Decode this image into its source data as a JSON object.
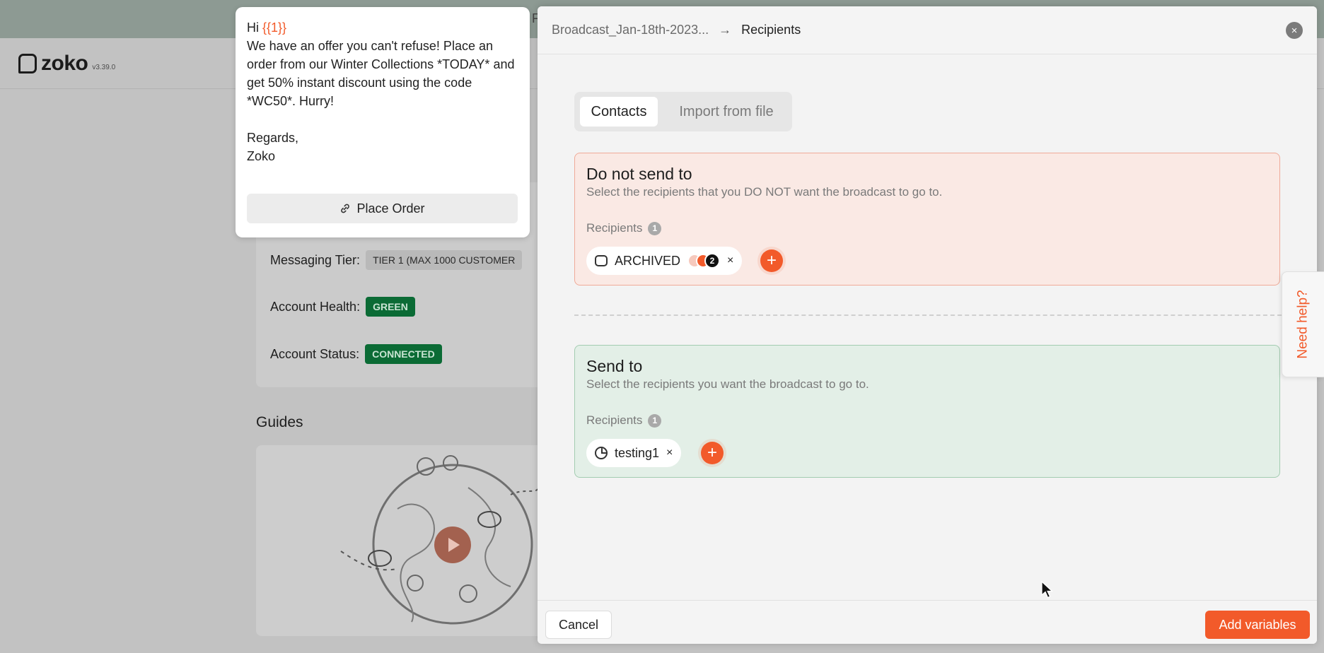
{
  "app": {
    "logo_text": "zoko",
    "version": "v3.39.0"
  },
  "background": {
    "header_letter": "F",
    "messaging_tier_label": "Messaging Tier:",
    "messaging_tier_value": "TIER 1 (MAX 1000 CUSTOMER",
    "account_health_label": "Account Health:",
    "account_health_value": "GREEN",
    "account_status_label": "Account Status:",
    "account_status_value": "CONNECTED",
    "guides_title": "Guides"
  },
  "preview": {
    "greeting": "Hi ",
    "variable": "{{1}}",
    "body": "We have an offer you can't refuse! Place an order from our Winter Collections  *TODAY* and get 50% instant discount using the code *WC50*. Hurry!\n\nRegards,\nZoko",
    "button_label": "Place Order"
  },
  "panel": {
    "breadcrumb": [
      "Broadcast_Jan-18th-2023...",
      "Recipients"
    ],
    "close_glyph": "×",
    "tabs": [
      {
        "label": "Contacts",
        "active": true
      },
      {
        "label": "Import from file",
        "active": false
      }
    ],
    "exclude": {
      "title": "Do not send to",
      "subtitle": "Select the recipients that you DO NOT want the broadcast to go to.",
      "recipients_label": "Recipients",
      "count": "1",
      "chip": {
        "label": "ARCHIVED",
        "avatar_count": "2",
        "remove": "×"
      }
    },
    "include": {
      "title": "Send to",
      "subtitle": "Select the recipients you want the broadcast to go to.",
      "recipients_label": "Recipients",
      "count": "1",
      "chip": {
        "label": "testing1",
        "remove": "×"
      }
    },
    "add_glyph": "+",
    "footer": {
      "cancel_label": "Cancel",
      "primary_label": "Add variables"
    }
  },
  "help": {
    "label": "Need help?"
  },
  "colors": {
    "accent": "#f25a2a",
    "exclude_bg": "#fae9e4",
    "include_bg": "#e3efe7",
    "status_green": "#0b6b35"
  }
}
